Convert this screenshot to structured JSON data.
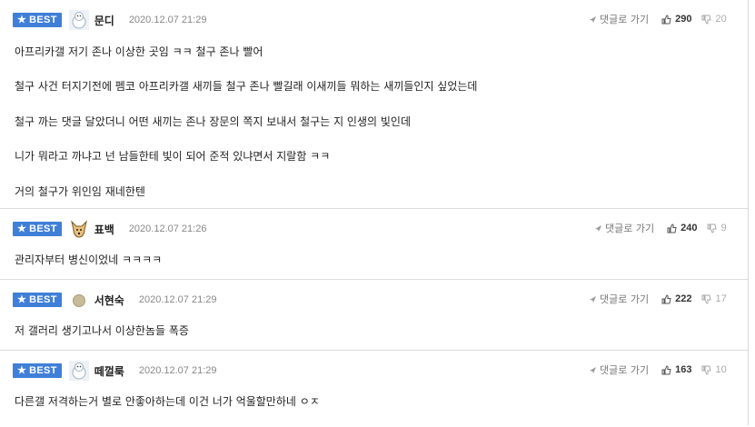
{
  "colors": {
    "badge": "#3f7fd8",
    "divider": "#dcdcdc",
    "date": "#888888"
  },
  "comments": [
    {
      "badge": "BEST",
      "nickname": "문디",
      "date": "2020.12.07 21:29",
      "reply": "댓글로 가기",
      "up": "290",
      "down": "20",
      "avatar_icon": "snowman-avatar-icon",
      "lines": [
        "아프리카갤 저기 존나 이상한 곳임 ㅋㅋ 철구 존나 빨어",
        "철구 사건 터지기전에 펨코 아프리카갤 새끼들 철구 존나 빨길래 이새끼들 뭐하는 새끼들인지 싶었는데",
        "철구 까는 댓글 달았더니 어떤 새끼는 존나 장문의 쪽지 보내서 철구는 지 인생의 빛인데",
        "니가 뭐라고 까냐고 넌 남들한테 빛이 되어 준적 있냐면서 지랄함 ㅋㅋ",
        "거의 철구가 위인임 재네한텐"
      ]
    },
    {
      "badge": "BEST",
      "nickname": "표백",
      "date": "2020.12.07 21:26",
      "reply": "댓글로 가기",
      "up": "240",
      "down": "9",
      "avatar_icon": "dog-avatar-icon",
      "lines": [
        "관리자부터 병신이었네 ㅋㅋㅋㅋ"
      ]
    },
    {
      "badge": "BEST",
      "nickname": "서현숙",
      "date": "2020.12.07 21:29",
      "reply": "댓글로 가기",
      "up": "222",
      "down": "17",
      "avatar_icon": "dot-avatar-icon",
      "lines": [
        "저 갤러리 생기고나서 이상한놈들 폭증"
      ]
    },
    {
      "badge": "BEST",
      "nickname": "떼껄룩",
      "date": "2020.12.07 21:29",
      "reply": "댓글로 가기",
      "up": "163",
      "down": "10",
      "avatar_icon": "snowman-avatar-icon",
      "lines": [
        "다른갤 저격하는거 별로 안좋아하는데 이건 너가 억울할만하네 ㅇㅈ"
      ]
    }
  ]
}
